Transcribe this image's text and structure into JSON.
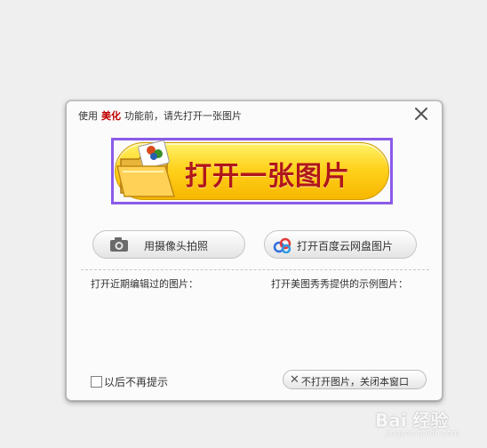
{
  "dialog": {
    "title_prefix": "使用",
    "title_keyword": "美化",
    "title_suffix": "功能前，请先打开一张图片",
    "close_icon": "close-icon"
  },
  "open_button": {
    "label": "打开一张图片",
    "icon": "folder-photo-icon"
  },
  "camera_button": {
    "label": "用摄像头拍照",
    "icon": "camera-icon"
  },
  "cloud_button": {
    "label": "打开百度云网盘图片",
    "icon": "baidu-cloud-icon"
  },
  "recent": {
    "label": "打开近期编辑过的图片："
  },
  "samples": {
    "label": "打开美图秀秀提供的示例图片："
  },
  "footer": {
    "no_prompt_label": "以后不再提示",
    "no_prompt_checked": false,
    "close_window_label": "不打开图片，关闭本窗口"
  },
  "watermark": {
    "text": "Bai 经验",
    "sub": "jingyan.baidu.com"
  },
  "colors": {
    "highlight": "#8b5be8",
    "button_text": "#b0161b",
    "button_fill": "#ffd21d"
  }
}
